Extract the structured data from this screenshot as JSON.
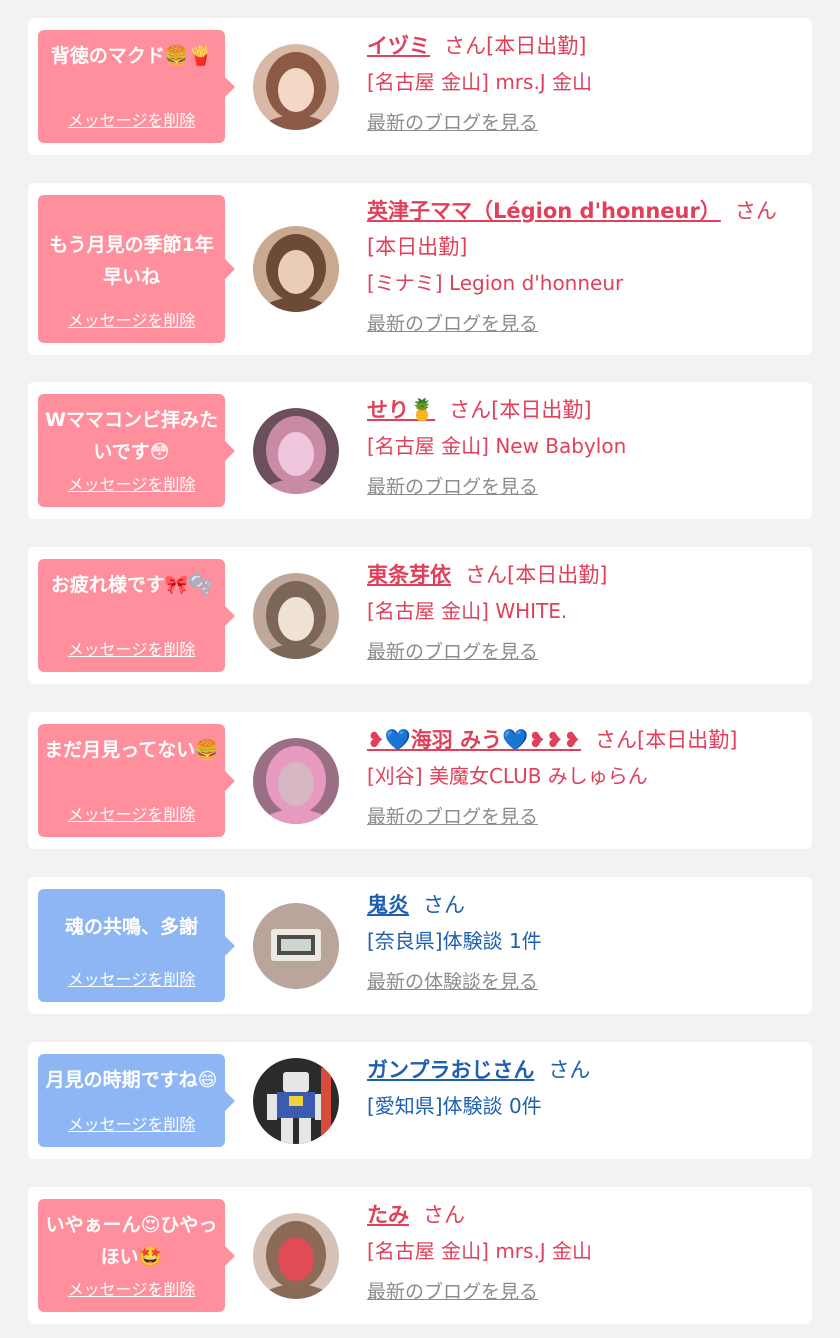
{
  "delete_label": "メッセージを削除",
  "honorific": "さん",
  "colors": {
    "pink_bubble": "#ff8f9d",
    "blue_bubble": "#8fb6f4",
    "pink_text": "#e0405a",
    "blue_text": "#1f5fb0",
    "link_gray": "#8c8c8c"
  },
  "items": [
    {
      "theme": "pink",
      "message": "背徳のマクド🍔🍟",
      "name": "イヅミ",
      "status": "[本日出勤]",
      "shop": "[名古屋 金山] mrs.J 金山",
      "link": "最新のブログを見る",
      "avatar_icon": "woman-photo"
    },
    {
      "theme": "pink",
      "message": "もう月見の季節1年早いね",
      "name": "英津子ママ（Légion d'honneur）",
      "status": "[本日出勤]",
      "shop": "[ミナミ] Legion d'honneur",
      "link": "最新のブログを見る",
      "avatar_icon": "woman-photo"
    },
    {
      "theme": "pink",
      "message": "Wママコンビ拝みたいです😳",
      "name": "せり🍍",
      "status": "[本日出勤]",
      "shop": "[名古屋 金山] New Babylon",
      "link": "最新のブログを見る",
      "avatar_icon": "woman-photo"
    },
    {
      "theme": "pink",
      "message": "お疲れ様です🎀🫧",
      "name": "東条芽依",
      "status": "[本日出勤]",
      "shop": "[名古屋 金山] WHITE.",
      "link": "最新のブログを見る",
      "avatar_icon": "woman-photo"
    },
    {
      "theme": "pink",
      "message": "まだ月見ってない🍔",
      "name": "❥💙海羽 みう💙❥❥❥",
      "status": "[本日出勤]",
      "shop": "[刈谷] 美魔女CLUB みしゅらん",
      "link": "最新のブログを見る",
      "avatar_icon": "woman-photo"
    },
    {
      "theme": "blue",
      "message": "魂の共鳴、多謝",
      "name": "鬼炎",
      "status": "",
      "shop": "[奈良県]体験談 1件",
      "link": "最新の体験談を見る",
      "avatar_icon": "clock-photo"
    },
    {
      "theme": "blue",
      "message": "月見の時期ですね😄",
      "name": "ガンプラおじさん",
      "status": "",
      "shop": "[愛知県]体験談 0件",
      "link": "",
      "avatar_icon": "robot-model-photo"
    },
    {
      "theme": "pink",
      "message": "いやぁーん😍ひやっほい🤩",
      "name": "たみ",
      "status": "",
      "shop": "[名古屋 金山] mrs.J 金山",
      "link": "最新のブログを見る",
      "avatar_icon": "woman-photo"
    }
  ]
}
